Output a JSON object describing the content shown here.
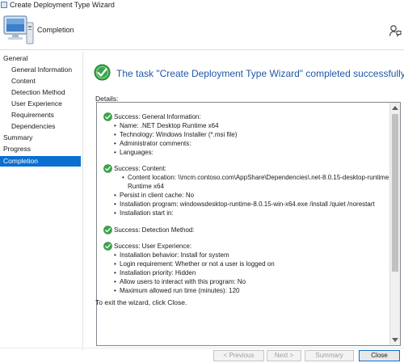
{
  "window": {
    "title": "Create Deployment Type Wizard"
  },
  "header": {
    "title": "Completion"
  },
  "sidebar": {
    "items": [
      {
        "label": "General",
        "level": 0,
        "active": false
      },
      {
        "label": "General Information",
        "level": 1,
        "active": false
      },
      {
        "label": "Content",
        "level": 1,
        "active": false
      },
      {
        "label": "Detection Method",
        "level": 1,
        "active": false
      },
      {
        "label": "User Experience",
        "level": 1,
        "active": false
      },
      {
        "label": "Requirements",
        "level": 1,
        "active": false
      },
      {
        "label": "Dependencies",
        "level": 1,
        "active": false
      },
      {
        "label": "Summary",
        "level": 0,
        "active": false
      },
      {
        "label": "Progress",
        "level": 0,
        "active": false
      },
      {
        "label": "Completion",
        "level": 0,
        "active": true
      }
    ]
  },
  "main": {
    "message": "The task \"Create Deployment Type Wizard\" completed successfully",
    "details_label": "Details:",
    "exit_text": "To exit the wizard, click Close."
  },
  "details": {
    "general": {
      "title": "Success: General Information:",
      "items": [
        "Name: .NET Desktop Runtime x64",
        "Technology: Windows Installer (*.msi file)",
        "Administrator comments:",
        "Languages:"
      ]
    },
    "content": {
      "title": "Success: Content:",
      "location_line1": "Content location: \\\\mcm.contoso.com\\AppShare\\Dependencies\\.net-8.0.15-desktop-runtime",
      "location_line2": "Runtime x64",
      "items": [
        "Persist in client cache: No",
        "Installation program: windowsdesktop-runtime-8.0.15-win-x64.exe /install /quiet /norestart",
        "Installation start in:"
      ]
    },
    "detection": {
      "title": "Success: Detection Method:"
    },
    "user_experience": {
      "title": "Success: User Experience:",
      "items": [
        "Installation behavior: Install for system",
        "Login requirement: Whether or not a user is logged on",
        "Installation priority: Hidden",
        "Allow users to interact with this program: No",
        "Maximum allowed run time (minutes): 120"
      ]
    }
  },
  "buttons": {
    "previous": "< Previous",
    "next": "Next >",
    "summary": "Summary",
    "close": "Close"
  },
  "colors": {
    "accent": "#0a6fd0",
    "message": "#1f57a8",
    "success": "#2e9a3e"
  }
}
